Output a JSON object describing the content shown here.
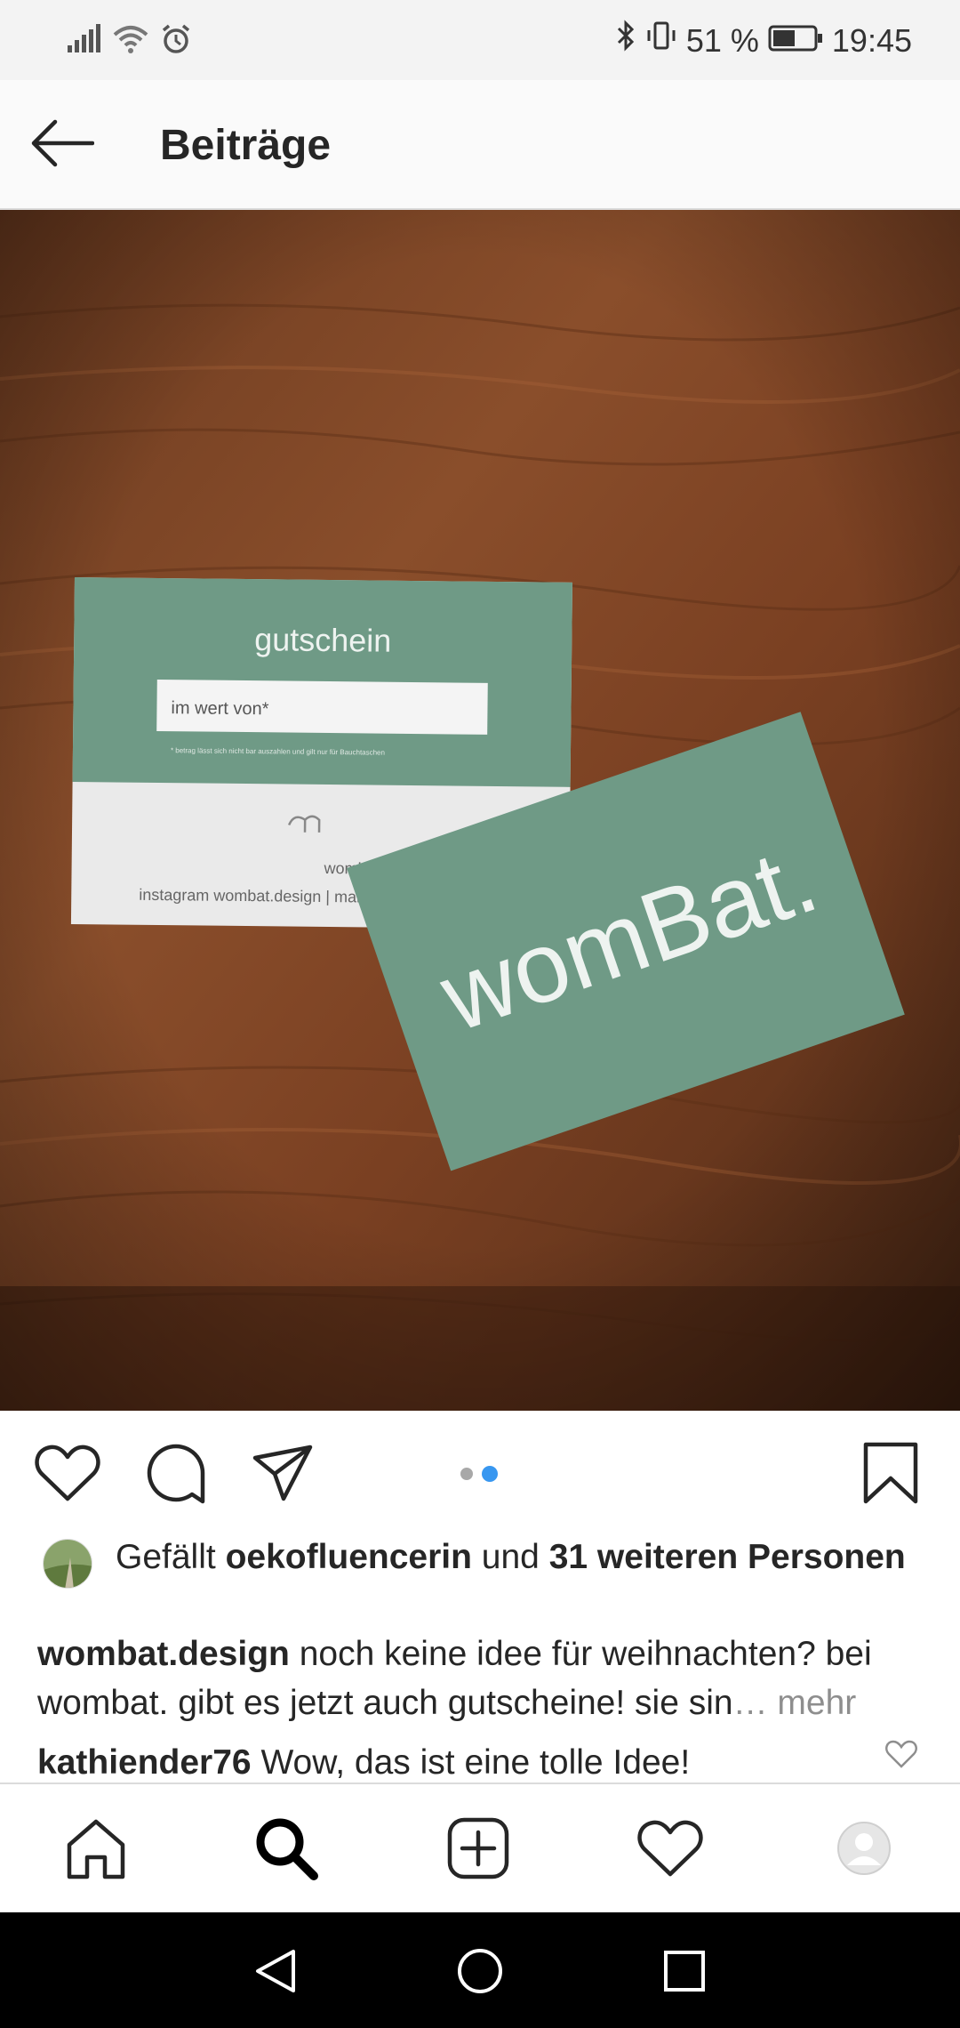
{
  "status_bar": {
    "battery_percent": "51 %",
    "time": "19:45",
    "icons": [
      "signal-icon",
      "wifi-icon",
      "alarm-icon",
      "bluetooth-icon",
      "vibrate-icon",
      "battery-icon"
    ]
  },
  "header": {
    "title": "Beiträge",
    "back_icon": "arrow-left-icon"
  },
  "post": {
    "image": {
      "voucher_title": "gutschein",
      "voucher_field": "im wert von*",
      "voucher_footnote": "* betrag lässt sich nicht bar auszahlen und gilt nur für Bauchtaschen",
      "voucher_line1": "wombat.design | p",
      "voucher_line2": "instagram wombat.design | mail w",
      "card_logo": "womBat."
    },
    "carousel": {
      "count": 2,
      "active_index": 1
    },
    "likes": {
      "prefix": "Gefällt ",
      "user": "oekofluencerin",
      "middle": " und ",
      "others": "31 weiteren Personen"
    },
    "caption": {
      "user": "wombat.design",
      "text": " noch keine idee für weihnachten? bei wombat. gibt es jetzt auch gutscheine! sie sin",
      "ellipsis": "…",
      "more": " mehr"
    },
    "comment": {
      "user": "kathiender76",
      "text": " Wow,  das ist eine tolle Idee!"
    }
  },
  "colors": {
    "accent_blue": "#3897f0",
    "text": "#262626",
    "muted": "#8e8e8e",
    "card_green": "#6f9a86"
  },
  "bottom_nav": [
    "home-icon",
    "search-icon",
    "add-post-icon",
    "activity-heart-icon",
    "profile-avatar-icon"
  ],
  "system_nav": [
    "back-triangle-icon",
    "home-circle-icon",
    "recents-square-icon"
  ]
}
